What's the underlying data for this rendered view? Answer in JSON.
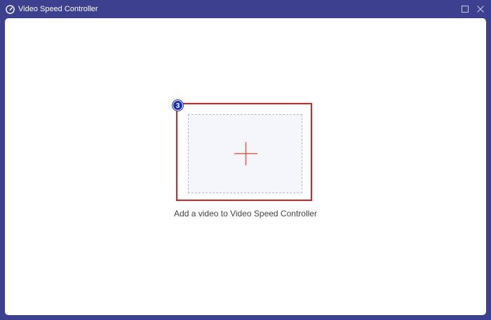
{
  "window": {
    "title": "Video Speed Controller",
    "app_icon": "speedometer-icon",
    "controls": {
      "maximize_icon": "maximize-icon",
      "close_icon": "close-icon"
    }
  },
  "main": {
    "add_video_caption": "Add a video to Video Speed Controller",
    "add_icon": "plus-icon",
    "step_badge": "3"
  },
  "colors": {
    "titlebar": "#3d3f8f",
    "highlight": "#e02020",
    "plus": "#e84a3a",
    "badge": "#1b2fbf",
    "dropzone_bg": "#f4f6fb"
  }
}
